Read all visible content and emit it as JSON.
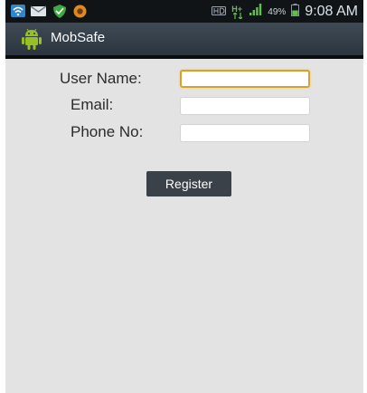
{
  "status_bar": {
    "icons": [
      "wifi-icon",
      "mail-icon",
      "shield-icon",
      "app-notification-icon",
      "hd-icon",
      "network-type-icon",
      "signal-icon",
      "battery-icon"
    ],
    "network_type": "H+",
    "battery_percent": "49%",
    "time": "9:08 AM"
  },
  "action_bar": {
    "icon": "android-icon",
    "title": "MobSafe"
  },
  "form": {
    "username_label": "User Name:",
    "username_value": "",
    "email_label": "Email:",
    "email_value": "",
    "phone_label": "Phone No:",
    "phone_value": "",
    "register_label": "Register"
  },
  "colors": {
    "status_bar": "#111417",
    "action_bar": "#2c353e",
    "android_green": "#97c024",
    "focus_border": "#d9a227",
    "background": "#e3e3e3",
    "button": "#3b4148"
  }
}
